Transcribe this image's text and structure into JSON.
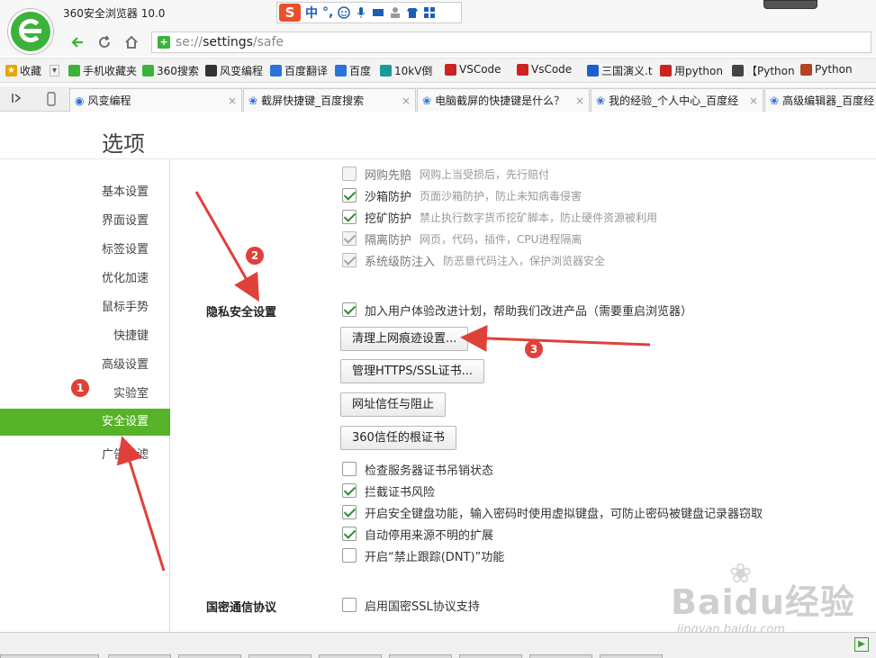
{
  "window": {
    "title": "360安全浏览器 10.0"
  },
  "ime": {
    "logo": "S",
    "mode": "中",
    "punct": "°,"
  },
  "address": {
    "scheme": "se://",
    "host": "settings",
    "path": "/safe"
  },
  "bookmarks": [
    {
      "label": "收藏",
      "color": "#e8a400"
    },
    {
      "label": "手机收藏夹",
      "color": "#3cb23c"
    },
    {
      "label": "360搜索",
      "color": "#3cb23c"
    },
    {
      "label": "风变编程",
      "color": "#333333"
    },
    {
      "label": "百度翻译",
      "color": "#2b73d8"
    },
    {
      "label": "百度",
      "color": "#2b73d8"
    },
    {
      "label": "10kV倒",
      "color": "#1a9a9a"
    },
    {
      "label": "VSCode",
      "color": "#cc2222"
    },
    {
      "label": "VsCode",
      "color": "#cc2222"
    },
    {
      "label": "三国演义.t",
      "color": "#1a5fd0"
    },
    {
      "label": "用python",
      "color": "#cc2222"
    },
    {
      "label": "【Python",
      "color": "#444444"
    },
    {
      "label": "Python",
      "color": "#b24422"
    }
  ],
  "tabs": [
    {
      "label": "风变编程"
    },
    {
      "label": "截屏快捷键_百度搜索"
    },
    {
      "label": "电脑截屏的快捷键是什么？"
    },
    {
      "label": "我的经验_个人中心_百度经"
    },
    {
      "label": "高级编辑器_百度经"
    }
  ],
  "page": {
    "title": "选项"
  },
  "sidebar": {
    "items": [
      {
        "label": "基本设置"
      },
      {
        "label": "界面设置"
      },
      {
        "label": "标签设置"
      },
      {
        "label": "优化加速"
      },
      {
        "label": "鼠标手势"
      },
      {
        "label": "快捷键"
      },
      {
        "label": "高级设置"
      },
      {
        "label": "实验室"
      },
      {
        "label": "安全设置"
      },
      {
        "label": "广告过滤"
      }
    ],
    "active_index": 8,
    "accent": "#56b327"
  },
  "protection": [
    {
      "name": "网购先赔",
      "desc": "网购上当受损后，先行赔付",
      "checked": false,
      "disabled": true
    },
    {
      "name": "沙箱防护",
      "desc": "页面沙箱防护，防止未知病毒侵害",
      "checked": true,
      "disabled": false
    },
    {
      "name": "挖矿防护",
      "desc": "禁止执行数字货币挖矿脚本，防止硬件资源被利用",
      "checked": true,
      "disabled": false
    },
    {
      "name": "隔离防护",
      "desc": "网页，代码，插件，CPU进程隔离",
      "checked": true,
      "disabled": true
    },
    {
      "name": "系统级防注入",
      "desc": "防恶意代码注入，保护浏览器安全",
      "checked": true,
      "disabled": true
    }
  ],
  "privacy": {
    "label": "隐私安全设置",
    "improve_checkbox": "加入用户体验改进计划，帮助我们改进产品（需要重启浏览器）",
    "buttons": [
      "清理上网痕迹设置...",
      "管理HTTPS/SSL证书...",
      "网址信任与阻止",
      "360信任的根证书"
    ],
    "options": [
      {
        "label": "检查服务器证书吊销状态",
        "checked": false
      },
      {
        "label": "拦截证书风险",
        "checked": true
      },
      {
        "label": "开启安全键盘功能，输入密码时使用虚拟键盘，可防止密码被键盘记录器窃取",
        "checked": true
      },
      {
        "label": "自动停用来源不明的扩展",
        "checked": true
      },
      {
        "label": "开启“禁止跟踪(DNT)”功能",
        "checked": false
      }
    ]
  },
  "crypto": {
    "label": "国密通信协议",
    "option": "启用国密SSL协议支持",
    "checked": false
  },
  "annotations": {
    "badge1": "1",
    "badge2": "2",
    "badge3": "3",
    "color": "#e0403a"
  },
  "watermark": {
    "main": "Baidu经验",
    "sub": "jingyan.baidu.com"
  }
}
